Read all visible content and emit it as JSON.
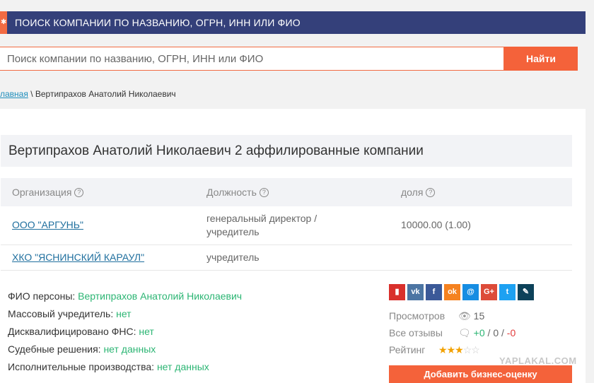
{
  "topbar": {
    "title": "ПОИСК КОМПАНИИ ПО НАЗВАНИЮ, ОГРН, ИНН ИЛИ ФИО"
  },
  "search": {
    "placeholder": "Поиск компании по названию, ОГРН, ИНН или ФИО",
    "button_label": "Найти"
  },
  "breadcrumb": {
    "home": "лавная",
    "separator": " \\ ",
    "current": "Вертипрахов Анатолий Николаевич"
  },
  "heading": "Вертипрахов Анатолий Николаевич 2 аффилированные компании",
  "table": {
    "headers": [
      "Организация",
      "Должность",
      "доля"
    ],
    "rows": [
      {
        "org": "ООО \"АРГУНЬ\"",
        "role": "генеральный директор / учредитель",
        "share": "10000.00 (1.00)"
      },
      {
        "org": "ХКО \"ЯСНИНСКИЙ КАРАУЛ\"",
        "role": "учредитель",
        "share": ""
      }
    ]
  },
  "facts": [
    {
      "label": "ФИО персоны: ",
      "value": "Вертипрахов Анатолий Николаевич"
    },
    {
      "label": "Массовый учредитель: ",
      "value": "нет"
    },
    {
      "label": "Дисквалифицировано ФНС: ",
      "value": "нет"
    },
    {
      "label": "Судебные решения: ",
      "value": "нет данных"
    },
    {
      "label": "Исполнительные производства: ",
      "value": "нет данных"
    }
  ],
  "social": [
    {
      "name": "bookmark",
      "color": "#d9302c",
      "glyph": "▮"
    },
    {
      "name": "vk",
      "color": "#4c75a3",
      "glyph": "vk"
    },
    {
      "name": "facebook",
      "color": "#3b5998",
      "glyph": "f"
    },
    {
      "name": "odnoklassniki",
      "color": "#f58220",
      "glyph": "ok"
    },
    {
      "name": "moimir",
      "color": "#168de2",
      "glyph": "@"
    },
    {
      "name": "googleplus",
      "color": "#dd4b39",
      "glyph": "G+"
    },
    {
      "name": "twitter",
      "color": "#1da1f2",
      "glyph": "t"
    },
    {
      "name": "livejournal",
      "color": "#0d425a",
      "glyph": "✎"
    }
  ],
  "stats": {
    "views_label": "Просмотров",
    "views_value": "15",
    "reviews_label": "Все отзывы",
    "reviews_plus": "+0",
    "reviews_neutral": "0",
    "reviews_minus": "-0",
    "rating_label": "Рейтинг",
    "rating_value": 3,
    "rating_max": 5
  },
  "rate_button": "Добавить бизнес-оценку",
  "watermark": "YAPLAKAL.COM"
}
